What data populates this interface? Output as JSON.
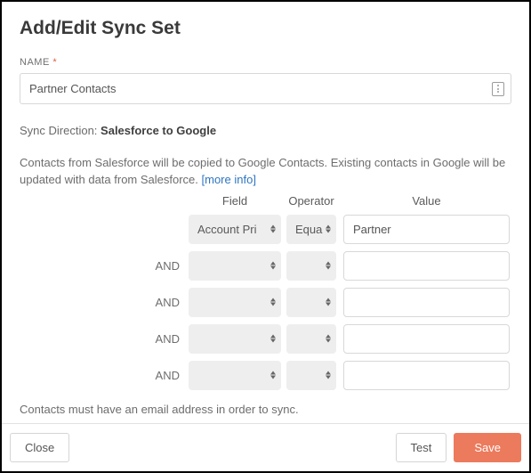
{
  "title": "Add/Edit Sync Set",
  "name_field": {
    "label": "NAME",
    "required_mark": "*",
    "value": "Partner Contacts"
  },
  "sync_direction": {
    "label": "Sync Direction:",
    "value": "Salesforce to Google"
  },
  "description": {
    "text": "Contacts from Salesforce will be copied to Google Contacts. Existing contacts in Google will be updated with data from Salesforce. ",
    "more_info": "[more info]"
  },
  "filters": {
    "headers": {
      "field": "Field",
      "operator": "Operator",
      "value": "Value"
    },
    "and_label": "AND",
    "rows": [
      {
        "and": "",
        "field": "Account Pri",
        "operator": "Equa",
        "value": "Partner"
      },
      {
        "and": "AND",
        "field": "",
        "operator": "",
        "value": ""
      },
      {
        "and": "AND",
        "field": "",
        "operator": "",
        "value": ""
      },
      {
        "and": "AND",
        "field": "",
        "operator": "",
        "value": ""
      },
      {
        "and": "AND",
        "field": "",
        "operator": "",
        "value": ""
      }
    ]
  },
  "note": "Contacts must have an email address in order to sync.",
  "buttons": {
    "close": "Close",
    "test": "Test",
    "save": "Save"
  }
}
